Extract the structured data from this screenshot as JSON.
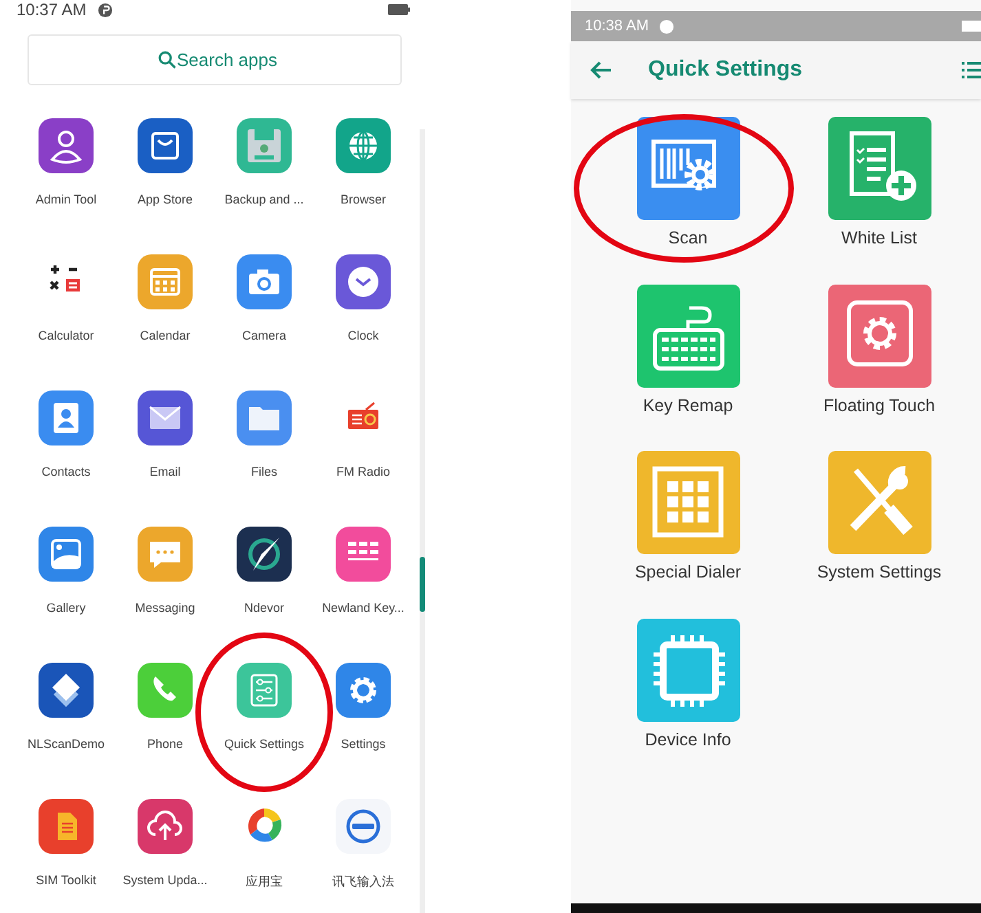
{
  "left_screen": {
    "status_bar": {
      "time": "10:37 AM"
    },
    "search": {
      "placeholder": "Search apps"
    },
    "apps": [
      {
        "label": "Admin Tool",
        "circled": false
      },
      {
        "label": "App Store",
        "circled": false
      },
      {
        "label": "Backup and ...",
        "circled": false
      },
      {
        "label": "Browser",
        "circled": false
      },
      {
        "label": "Calculator",
        "circled": false
      },
      {
        "label": "Calendar",
        "circled": false
      },
      {
        "label": "Camera",
        "circled": false
      },
      {
        "label": "Clock",
        "circled": false
      },
      {
        "label": "Contacts",
        "circled": false
      },
      {
        "label": "Email",
        "circled": false
      },
      {
        "label": "Files",
        "circled": false
      },
      {
        "label": "FM Radio",
        "circled": false
      },
      {
        "label": "Gallery",
        "circled": false
      },
      {
        "label": "Messaging",
        "circled": false
      },
      {
        "label": "Ndevor",
        "circled": false
      },
      {
        "label": "Newland Key...",
        "circled": false
      },
      {
        "label": "NLScanDemo",
        "circled": false
      },
      {
        "label": "Phone",
        "circled": false
      },
      {
        "label": "Quick Settings",
        "circled": true
      },
      {
        "label": "Settings",
        "circled": false
      },
      {
        "label": "SIM Toolkit",
        "circled": false
      },
      {
        "label": "System Upda...",
        "circled": false
      },
      {
        "label": "应用宝",
        "circled": false
      },
      {
        "label": "讯飞输入法",
        "circled": false
      }
    ]
  },
  "right_screen": {
    "status_bar": {
      "time": "10:38 AM"
    },
    "toolbar": {
      "title": "Quick Settings"
    },
    "tiles": [
      {
        "label": "Scan",
        "circled": true
      },
      {
        "label": "White List",
        "circled": false
      },
      {
        "label": "Key Remap",
        "circled": false
      },
      {
        "label": "Floating Touch",
        "circled": false
      },
      {
        "label": "Special Dialer",
        "circled": false
      },
      {
        "label": "System Settings",
        "circled": false
      },
      {
        "label": "Device Info",
        "circled": false
      }
    ]
  }
}
